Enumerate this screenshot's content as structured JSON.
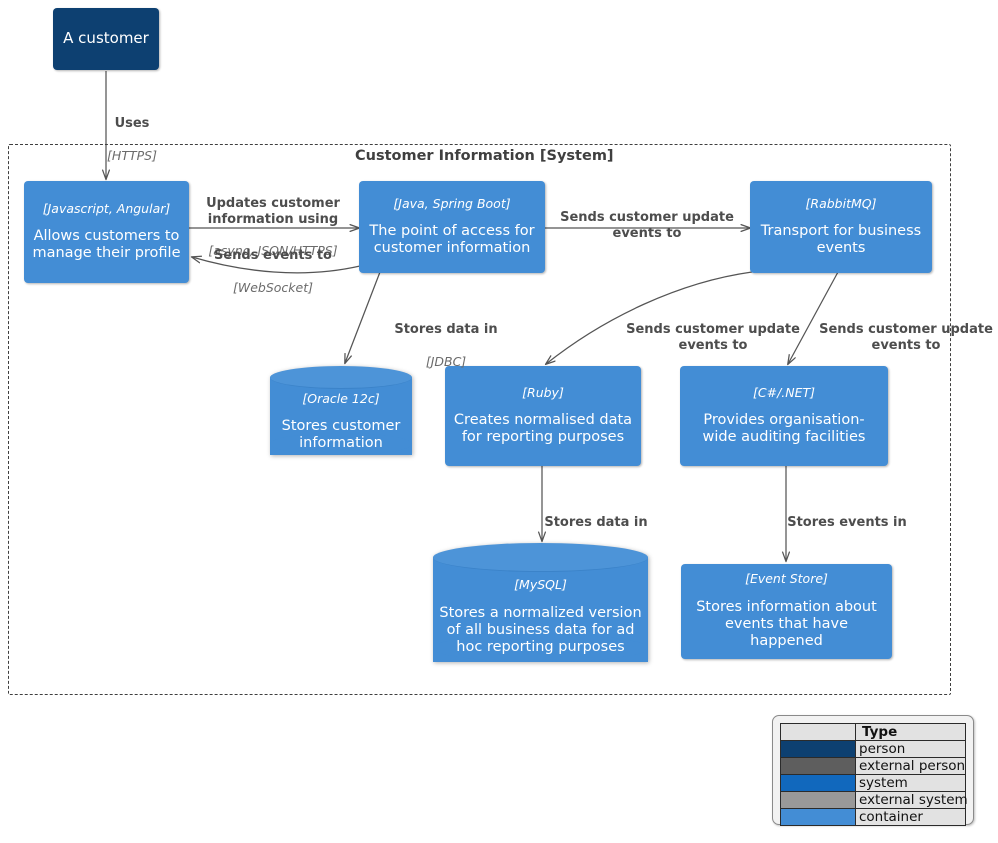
{
  "diagram": {
    "boundary_title": "Customer Information [System]"
  },
  "nodes": {
    "customer": {
      "name": "A customer",
      "tech": "",
      "desc": "",
      "type": "person"
    },
    "web_app": {
      "tech": "[Javascript, Angular]",
      "desc": "Allows customers to manage their profile",
      "type": "container"
    },
    "api": {
      "tech": "[Java, Spring Boot]",
      "desc": "The point of access for customer information",
      "type": "container"
    },
    "rabbitmq": {
      "tech": "[RabbitMQ]",
      "desc": "Transport for business events",
      "type": "container"
    },
    "oracle": {
      "tech": "[Oracle 12c]",
      "desc": "Stores customer information",
      "type": "database"
    },
    "reporting": {
      "tech": "[Ruby]",
      "desc": "Creates normalised data for reporting purposes",
      "type": "container"
    },
    "audit": {
      "tech": "[C#/.NET]",
      "desc": "Provides organisation-wide auditing facilities",
      "type": "container"
    },
    "mysql": {
      "tech": "[MySQL]",
      "desc": "Stores a normalized version of all business data for ad hoc reporting purposes",
      "type": "database"
    },
    "eventstore": {
      "tech": "[Event Store]",
      "desc": "Stores information about events that have happened",
      "type": "database"
    }
  },
  "edges": [
    {
      "id": "uses",
      "lead": "Uses",
      "tech": "[HTTPS]"
    },
    {
      "id": "updates",
      "lead": "Updates customer information using",
      "tech": "[async, JSON/HTTPS]"
    },
    {
      "id": "sends_events",
      "lead": "Sends events to",
      "tech": "[WebSocket]"
    },
    {
      "id": "api_to_rabbit",
      "lead": "Sends customer update events to",
      "tech": ""
    },
    {
      "id": "stores_jdbc",
      "lead": "Stores data in",
      "tech": "[JDBC]"
    },
    {
      "id": "rabbit_to_ruby",
      "lead": "Sends customer update events to",
      "tech": ""
    },
    {
      "id": "rabbit_to_audit",
      "lead": "Sends customer update events to",
      "tech": ""
    },
    {
      "id": "ruby_to_mysql",
      "lead": "Stores data in",
      "tech": ""
    },
    {
      "id": "audit_to_es",
      "lead": "Stores events in",
      "tech": ""
    }
  ],
  "legend": {
    "header": "Type",
    "rows": [
      {
        "label": "person",
        "color": "#0d4071"
      },
      {
        "label": "external person",
        "color": "#5e5e5e"
      },
      {
        "label": "system",
        "color": "#1168bd"
      },
      {
        "label": "external system",
        "color": "#999999"
      },
      {
        "label": "container",
        "color": "#438dd5"
      }
    ]
  }
}
